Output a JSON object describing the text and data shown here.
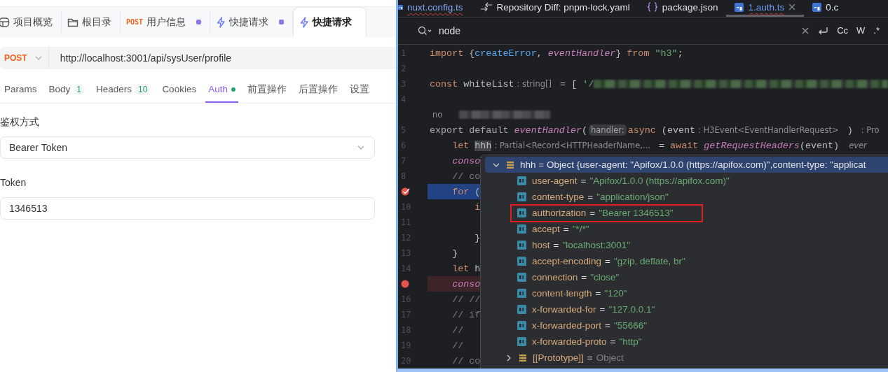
{
  "apifox": {
    "tabs": [
      {
        "kind": "overview",
        "label": "项目概览",
        "modified": false,
        "selected": false
      },
      {
        "kind": "folder",
        "label": "根目录",
        "modified": false,
        "selected": false
      },
      {
        "kind": "request",
        "method": "POST",
        "label": "用户信息",
        "modified": true,
        "selected": false
      },
      {
        "kind": "quick",
        "label": "快捷请求",
        "modified": true,
        "selected": false
      },
      {
        "kind": "quick",
        "label": "快捷请求",
        "modified": false,
        "selected": true
      }
    ],
    "request": {
      "method": "POST",
      "url": "http://localhost:3001/api/sysUser/profile"
    },
    "subtabs": [
      {
        "label": "Params",
        "selected": false
      },
      {
        "label": "Body",
        "count": "1",
        "selected": false
      },
      {
        "label": "Headers",
        "count": "10",
        "selected": false
      },
      {
        "label": "Cookies",
        "selected": false
      },
      {
        "label": "Auth",
        "dot": true,
        "selected": true
      },
      {
        "label": "前置操作",
        "selected": false
      },
      {
        "label": "后置操作",
        "selected": false
      },
      {
        "label": "设置",
        "selected": false
      }
    ],
    "auth": {
      "type_label": "鉴权方式",
      "type": "Bearer Token",
      "token_label": "Token",
      "token": "1346513"
    }
  },
  "ide": {
    "tabs": [
      {
        "kind": "typescript",
        "label": "nuxt.config.ts",
        "error": true,
        "selected": false
      },
      {
        "kind": "diff",
        "label": "Repository Diff: pnpm-lock.yaml",
        "error": false,
        "selected": false
      },
      {
        "kind": "json",
        "label": "package.json",
        "error": false,
        "selected": false
      },
      {
        "kind": "typescript",
        "label": "1.auth.ts",
        "error": true,
        "selected": true
      },
      {
        "kind": "typescript",
        "label": "0.c",
        "error": false,
        "selected": false
      }
    ],
    "search": {
      "query": "node",
      "options": [
        "Cc",
        "W",
        ".*"
      ]
    },
    "lines": [
      {
        "number": "1",
        "tokens": [
          {
            "kind": "kw",
            "text": "import "
          },
          {
            "kind": "plain",
            "text": "{"
          },
          {
            "kind": "call",
            "text": "createError"
          },
          {
            "kind": "plain",
            "text": ", "
          },
          {
            "kind": "fn",
            "text": "eventHandler"
          },
          {
            "kind": "plain",
            "text": "} "
          },
          {
            "kind": "kw",
            "text": "from "
          },
          {
            "kind": "str",
            "text": "\"h3\""
          },
          {
            "kind": "plain",
            "text": ";"
          }
        ]
      },
      {
        "number": "2"
      },
      {
        "number": "3",
        "tokens": [
          {
            "kind": "kw",
            "text": "const "
          },
          {
            "kind": "plain",
            "text": "whiteList"
          },
          {
            "kind": "hint",
            "text": ": string[]"
          },
          {
            "kind": "plain",
            "text": " = [ "
          },
          {
            "kind": "str",
            "text": "'/"
          },
          {
            "kind": "redacted_long"
          }
        ]
      },
      {
        "number": "4"
      },
      {
        "tokens": [
          {
            "kind": "hint",
            "text": "no"
          },
          {
            "kind": "redacted_short"
          }
        ]
      },
      {
        "number": "5",
        "tokens": [
          {
            "kind": "dim",
            "text": "export default "
          },
          {
            "kind": "fn",
            "text": "eventHandler"
          },
          {
            "kind": "plain",
            "text": "("
          },
          {
            "kind": "pill",
            "text": "handler:"
          },
          {
            "kind": "kw",
            "text": "async "
          },
          {
            "kind": "plain",
            "text": "(event"
          },
          {
            "kind": "hint",
            "text": ": H3Event<EventHandlerRequest>"
          },
          {
            "kind": "plain",
            "text": " ) "
          },
          {
            "kind": "hint",
            "text": ": Pro"
          }
        ]
      },
      {
        "number": "6",
        "tokens": [
          {
            "kind": "kw",
            "text": "    let "
          },
          {
            "kind": "occ",
            "text": "hhh"
          },
          {
            "kind": "hint",
            "text": ": Partial<Record<HTTPHeaderName,..."
          },
          {
            "kind": "plain",
            "text": " = "
          },
          {
            "kind": "kw",
            "text": "await "
          },
          {
            "kind": "fn",
            "text": "getRequestHeaders"
          },
          {
            "kind": "plain",
            "text": "(event)"
          },
          {
            "kind": "hintit",
            "text": "ever"
          }
        ]
      },
      {
        "number": "7",
        "tokens": [
          {
            "kind": "fn",
            "text": "    conso"
          }
        ]
      },
      {
        "number": "8",
        "tokens": [
          {
            "kind": "comment",
            "text": "    // co"
          }
        ]
      },
      {
        "kind": "execution_point",
        "tokens": [
          {
            "kind": "kw",
            "text": "    for "
          },
          {
            "kind": "plain",
            "text": "("
          }
        ]
      },
      {
        "number": "10",
        "tokens": [
          {
            "kind": "kw",
            "text": "        i"
          }
        ]
      },
      {
        "number": "11"
      },
      {
        "number": "12",
        "tokens": [
          {
            "kind": "plain",
            "text": "        }"
          }
        ]
      },
      {
        "number": "13",
        "tokens": [
          {
            "kind": "plain",
            "text": "    }"
          }
        ]
      },
      {
        "number": "14",
        "tokens": [
          {
            "kind": "kw",
            "text": "    let "
          },
          {
            "kind": "plain",
            "text": "h"
          }
        ]
      },
      {
        "kind": "breakpoint",
        "tokens": [
          {
            "kind": "fn",
            "text": "    conso"
          }
        ]
      },
      {
        "number": "16",
        "tokens": [
          {
            "kind": "comment",
            "text": "    // //"
          }
        ]
      },
      {
        "number": "17",
        "tokens": [
          {
            "kind": "comment",
            "text": "    // if"
          }
        ]
      },
      {
        "number": "18",
        "tokens": [
          {
            "kind": "comment",
            "text": "    //"
          }
        ]
      },
      {
        "number": "19",
        "tokens": [
          {
            "kind": "comment",
            "text": "    //"
          }
        ]
      },
      {
        "number": "20",
        "tokens": [
          {
            "kind": "comment",
            "text": "    // co"
          }
        ]
      }
    ],
    "debug_popup": {
      "header": {
        "expanded": true,
        "text": "hhh = Object {user-agent: \"Apifox/1.0.0 (https://apifox.com)\",content-type: \"applicat"
      },
      "rows": [
        {
          "kind": "field",
          "name": "user-agent",
          "operator": "=",
          "value": "\"Apifox/1.0.0 (https://apifox.com)\"",
          "outlined": false
        },
        {
          "kind": "field",
          "name": "content-type",
          "operator": "=",
          "value": "\"application/json\"",
          "outlined": false
        },
        {
          "kind": "field",
          "name": "authorization",
          "operator": "=",
          "value": "\"Bearer 1346513\"",
          "outlined": true
        },
        {
          "kind": "field",
          "name": "accept",
          "operator": "=",
          "value": "\"*/*\"",
          "outlined": false
        },
        {
          "kind": "field",
          "name": "host",
          "operator": "=",
          "value": "\"localhost:3001\"",
          "outlined": false
        },
        {
          "kind": "field",
          "name": "accept-encoding",
          "operator": "=",
          "value": "\"gzip, deflate, br\"",
          "outlined": false
        },
        {
          "kind": "field",
          "name": "connection",
          "operator": "=",
          "value": "\"close\"",
          "outlined": false
        },
        {
          "kind": "field",
          "name": "content-length",
          "operator": "=",
          "value": "\"120\"",
          "outlined": false
        },
        {
          "kind": "field",
          "name": "x-forwarded-for",
          "operator": "=",
          "value": "\"127.0.0.1\"",
          "outlined": false
        },
        {
          "kind": "field",
          "name": "x-forwarded-port",
          "operator": "=",
          "value": "\"55666\"",
          "outlined": false
        },
        {
          "kind": "field",
          "name": "x-forwarded-proto",
          "operator": "=",
          "value": "\"http\"",
          "outlined": false
        },
        {
          "kind": "object",
          "name": "[[Prototype]]",
          "operator": "=",
          "value": "Object",
          "expanded": false,
          "outlined": false
        }
      ]
    }
  }
}
